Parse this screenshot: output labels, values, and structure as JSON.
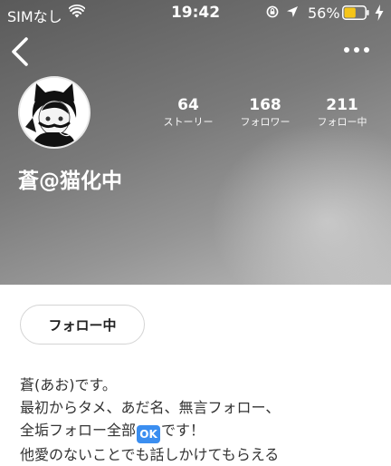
{
  "status_bar": {
    "carrier": "SIMなし",
    "time": "19:42",
    "battery_percent": "56%",
    "battery_level": 0.56,
    "battery_color": "#f5c518"
  },
  "header": {
    "back_icon": "chevron-left-icon",
    "more_icon": "more-horizontal-icon"
  },
  "profile": {
    "username": "蒼@猫化中",
    "stats": [
      {
        "value": "64",
        "label": "ストーリー"
      },
      {
        "value": "168",
        "label": "フォロワー"
      },
      {
        "value": "211",
        "label": "フォロー中"
      }
    ]
  },
  "actions": {
    "follow_button": "フォロー中"
  },
  "bio": {
    "line1": "蒼(あお)です。",
    "line2": "最初からタメ、あだ名、無言フォロー、",
    "line3_before": "全垢フォロー全部",
    "line3_badge": "OK",
    "line3_after": "です！",
    "line4": "他愛のないことでも話しかけてもらえる"
  }
}
